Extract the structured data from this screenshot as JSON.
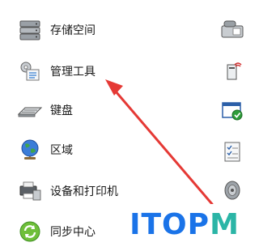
{
  "items": [
    {
      "label": "存储空间",
      "icon": "storage-spaces-icon"
    },
    {
      "label": "管理工具",
      "icon": "administrative-tools-icon"
    },
    {
      "label": "键盘",
      "icon": "keyboard-icon"
    },
    {
      "label": "区域",
      "icon": "region-globe-icon"
    },
    {
      "label": "设备和打印机",
      "icon": "devices-printers-icon"
    },
    {
      "label": "同步中心",
      "icon": "sync-center-icon"
    }
  ],
  "right_icons": [
    "phone-modem-icon",
    "remote-app-icon",
    "security-maintenance-icon",
    "task-list-icon",
    "sound-speaker-icon"
  ],
  "watermark": {
    "text_left": "ITOP",
    "text_right": "M",
    "color_left": "#1a73e8",
    "color_right": "#2bb5a6"
  },
  "colors": {
    "arrow": "#e53935"
  }
}
